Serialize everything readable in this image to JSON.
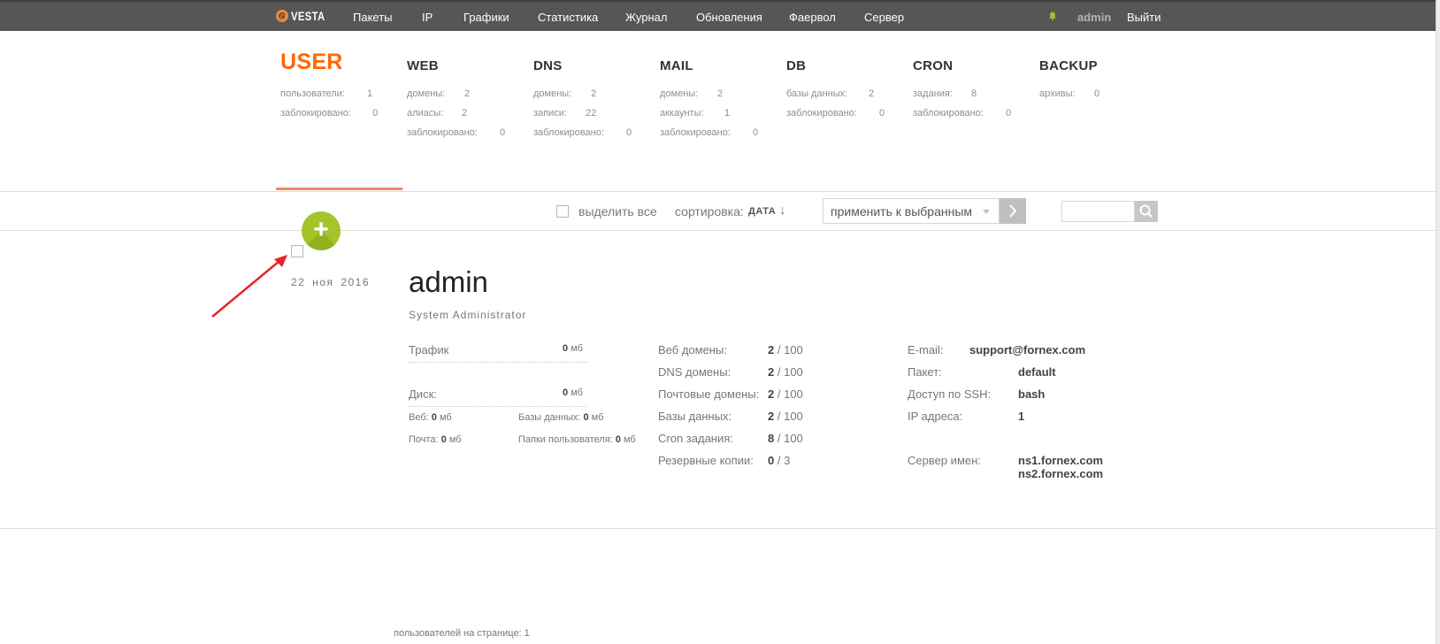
{
  "topbar": {
    "logo_text": "VESTA",
    "menu": [
      "Пакеты",
      "IP",
      "Графики",
      "Статистика",
      "Журнал",
      "Обновления",
      "Фаервол",
      "Сервер"
    ],
    "user": "admin",
    "logout": "Выйти"
  },
  "tabs": [
    {
      "title": "USER",
      "active": true,
      "stats": [
        {
          "label": "пользователи:",
          "value": "1"
        },
        {
          "label": "заблокировано:",
          "value": "0"
        }
      ]
    },
    {
      "title": "WEB",
      "stats": [
        {
          "label": "домены:",
          "value": "2"
        },
        {
          "label": "алиасы:",
          "value": "2"
        },
        {
          "label": "заблокировано:",
          "value": "0"
        }
      ]
    },
    {
      "title": "DNS",
      "stats": [
        {
          "label": "домены:",
          "value": "2"
        },
        {
          "label": "записи:",
          "value": "22"
        },
        {
          "label": "заблокировано:",
          "value": "0"
        }
      ]
    },
    {
      "title": "MAIL",
      "stats": [
        {
          "label": "домены:",
          "value": "2"
        },
        {
          "label": "аккаунты:",
          "value": "1"
        },
        {
          "label": "заблокировано:",
          "value": "0"
        }
      ]
    },
    {
      "title": "DB",
      "stats": [
        {
          "label": "базы данных:",
          "value": "2"
        },
        {
          "label": "заблокировано:",
          "value": "0"
        }
      ]
    },
    {
      "title": "CRON",
      "stats": [
        {
          "label": "задания:",
          "value": "8"
        },
        {
          "label": "заблокировано:",
          "value": "0"
        }
      ]
    },
    {
      "title": "BACKUP",
      "stats": [
        {
          "label": "архивы:",
          "value": "0"
        }
      ]
    }
  ],
  "toolbar": {
    "select_all": "выделить все",
    "sort_label": "сортировка:",
    "sort_value": "ДАТА",
    "sort_arrow": "↓",
    "bulk_action": "применить к выбранным",
    "search_placeholder": ""
  },
  "add_button": "+",
  "user_row": {
    "date": "22 ноя 2016",
    "name": "admin",
    "role": "System Administrator",
    "traffic_label": "Трафик",
    "traffic_value": "0",
    "disk_label": "Диск:",
    "disk_value": "0",
    "unit": "мб",
    "web_label": "Веб:",
    "web_value": "0",
    "db_label": "Базы данных:",
    "db_value": "0",
    "mail_label": "Почта:",
    "mail_value": "0",
    "userdir_label": "Папки пользователя:",
    "userdir_value": "0",
    "limits": [
      {
        "label": "Веб домены:",
        "used": "2",
        "max": "/ 100"
      },
      {
        "label": "DNS домены:",
        "used": "2",
        "max": "/ 100"
      },
      {
        "label": "Почтовые домены:",
        "used": "2",
        "max": "/ 100"
      },
      {
        "label": "Базы данных:",
        "used": "2",
        "max": "/ 100"
      },
      {
        "label": "Cron задания:",
        "used": "8",
        "max": "/ 100"
      },
      {
        "label": "Резервные копии:",
        "used": "0",
        "max": "/ 3"
      }
    ],
    "email_label": "E-mail:",
    "email_value": "support@fornex.com",
    "package_label": "Пакет:",
    "package_value": "default",
    "ssh_label": "Доступ по SSH:",
    "ssh_value": "bash",
    "ip_label": "IP адреса:",
    "ip_value": "1",
    "ns_label": "Сервер имен:",
    "ns1": "ns1.fornex.com",
    "ns2": "ns2.fornex.com"
  },
  "footer": "пользователей на странице: 1",
  "colors": {
    "accent": "#ff6701",
    "topbar": "#565656",
    "add_button": "#a5c42b",
    "arrow": "#e8232a"
  }
}
